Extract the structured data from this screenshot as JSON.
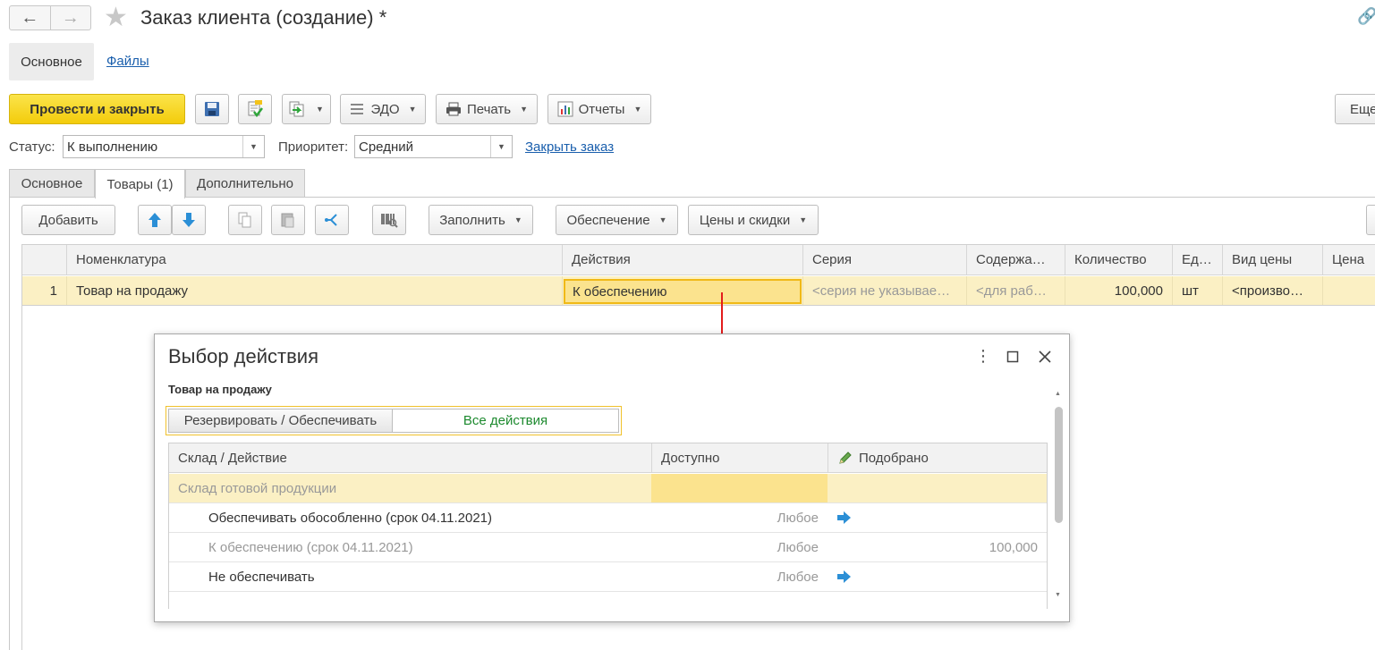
{
  "window": {
    "title": "Заказ клиента (создание) *",
    "nav_back_icon": "arrow-left-icon",
    "nav_forward_icon": "arrow-right-icon",
    "favorite_icon": "star-icon",
    "link_icon": "link-icon"
  },
  "section_nav": {
    "items": [
      {
        "label": "Основное",
        "active": true
      },
      {
        "label": "Файлы",
        "active": false
      }
    ]
  },
  "toolbar": {
    "post_close": "Провести и закрыть",
    "save_icon": "save-icon",
    "post_icon": "post-document-icon",
    "create_based_icon": "create-based-on-icon",
    "edo": "ЭДО",
    "print": "Печать",
    "reports": "Отчеты",
    "more": "Еще",
    "accent_color": "#f5d116"
  },
  "status_row": {
    "status_label": "Статус:",
    "status_value": "К выполнению",
    "priority_label": "Приоритет:",
    "priority_value": "Средний",
    "close_order": "Закрыть заказ"
  },
  "tabs": [
    {
      "label": "Основное",
      "active": false
    },
    {
      "label": "Товары (1)",
      "active": true
    },
    {
      "label": "Дополнительно",
      "active": false
    }
  ],
  "goods_toolbar": {
    "add": "Добавить",
    "move_up_icon": "arrow-up-icon",
    "move_down_icon": "arrow-down-icon",
    "copy_icon": "copy-icon",
    "paste_icon": "paste-icon",
    "split_icon": "split-icon",
    "barcode_icon": "barcode-icon",
    "fill": "Заполнить",
    "provision": "Обеспечение",
    "prices_discounts": "Цены и скидки"
  },
  "goods_table": {
    "columns": [
      "Номенклатура",
      "Действия",
      "Серия",
      "Содержа…",
      "Количество",
      "Ед…",
      "Вид цены",
      "Цена"
    ],
    "rows": [
      {
        "n": "1",
        "item": "Товар на продажу",
        "action": "К обеспечению",
        "series": "<серия не указывае…",
        "content": "<для раб…",
        "qty": "100,000",
        "unit": "шт",
        "price_type": "<произво…",
        "price": ""
      }
    ],
    "row_highlight_color": "#fbf0c4"
  },
  "dialog": {
    "title": "Выбор действия",
    "more_icon": "more-vertical-icon",
    "maximize_icon": "maximize-icon",
    "close_icon": "close-icon",
    "item_name": "Товар на продажу",
    "seg_reserve": "Резервировать / Обеспечивать",
    "seg_all": "Все действия",
    "columns": [
      "Склад / Действие",
      "Доступно",
      "Подобрано"
    ],
    "picked_icon": "pencil-icon",
    "group_row": "Склад готовой продукции",
    "rows": [
      {
        "action": "Обеспечивать обособленно (срок 04.11.2021)",
        "available": "Любое",
        "picked": "",
        "arrow": true,
        "dim": false
      },
      {
        "action": "К обеспечению (срок 04.11.2021)",
        "available": "Любое",
        "picked": "100,000",
        "arrow": false,
        "dim": true
      },
      {
        "action": "Не обеспечивать",
        "available": "Любое",
        "picked": "",
        "arrow": true,
        "dim": false
      }
    ],
    "select_arrow_icon": "arrow-right-blue-icon"
  }
}
